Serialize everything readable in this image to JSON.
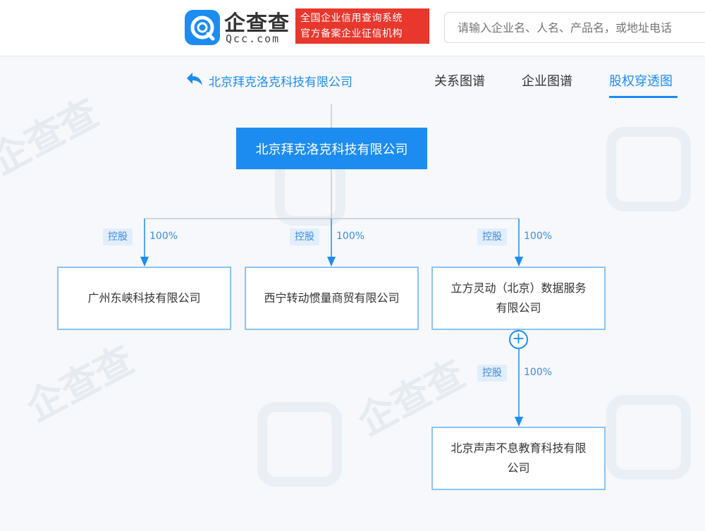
{
  "header": {
    "logo_cn": "企查查",
    "logo_en": "Qcc.com",
    "badge_line1": "全国企业信用查询系统",
    "badge_line2": "官方备案企业征信机构",
    "search_placeholder": "请输入企业名、人名、产品名，或地址电话"
  },
  "nav": {
    "back_title": "北京拜克洛克科技有限公司",
    "tabs": [
      {
        "label": "关系图谱"
      },
      {
        "label": "企业图谱"
      },
      {
        "label": "股权穿透图",
        "active": true
      }
    ],
    "accent": "#1d8cf0"
  },
  "tree": {
    "root": "北京拜克洛克科技有限公司",
    "children": [
      {
        "name": "广州东峡科技有限公司",
        "tag": "控股",
        "percent": "100%"
      },
      {
        "name": "西宁转动惯量商贸有限公司",
        "tag": "控股",
        "percent": "100%"
      },
      {
        "name": "立方灵动（北京）数据服务有限公司",
        "tag": "控股",
        "percent": "100%"
      }
    ],
    "grandchild": {
      "name": "北京声声不息教育科技有限公司",
      "tag": "控股",
      "percent": "100%"
    },
    "expand_label": "+"
  }
}
